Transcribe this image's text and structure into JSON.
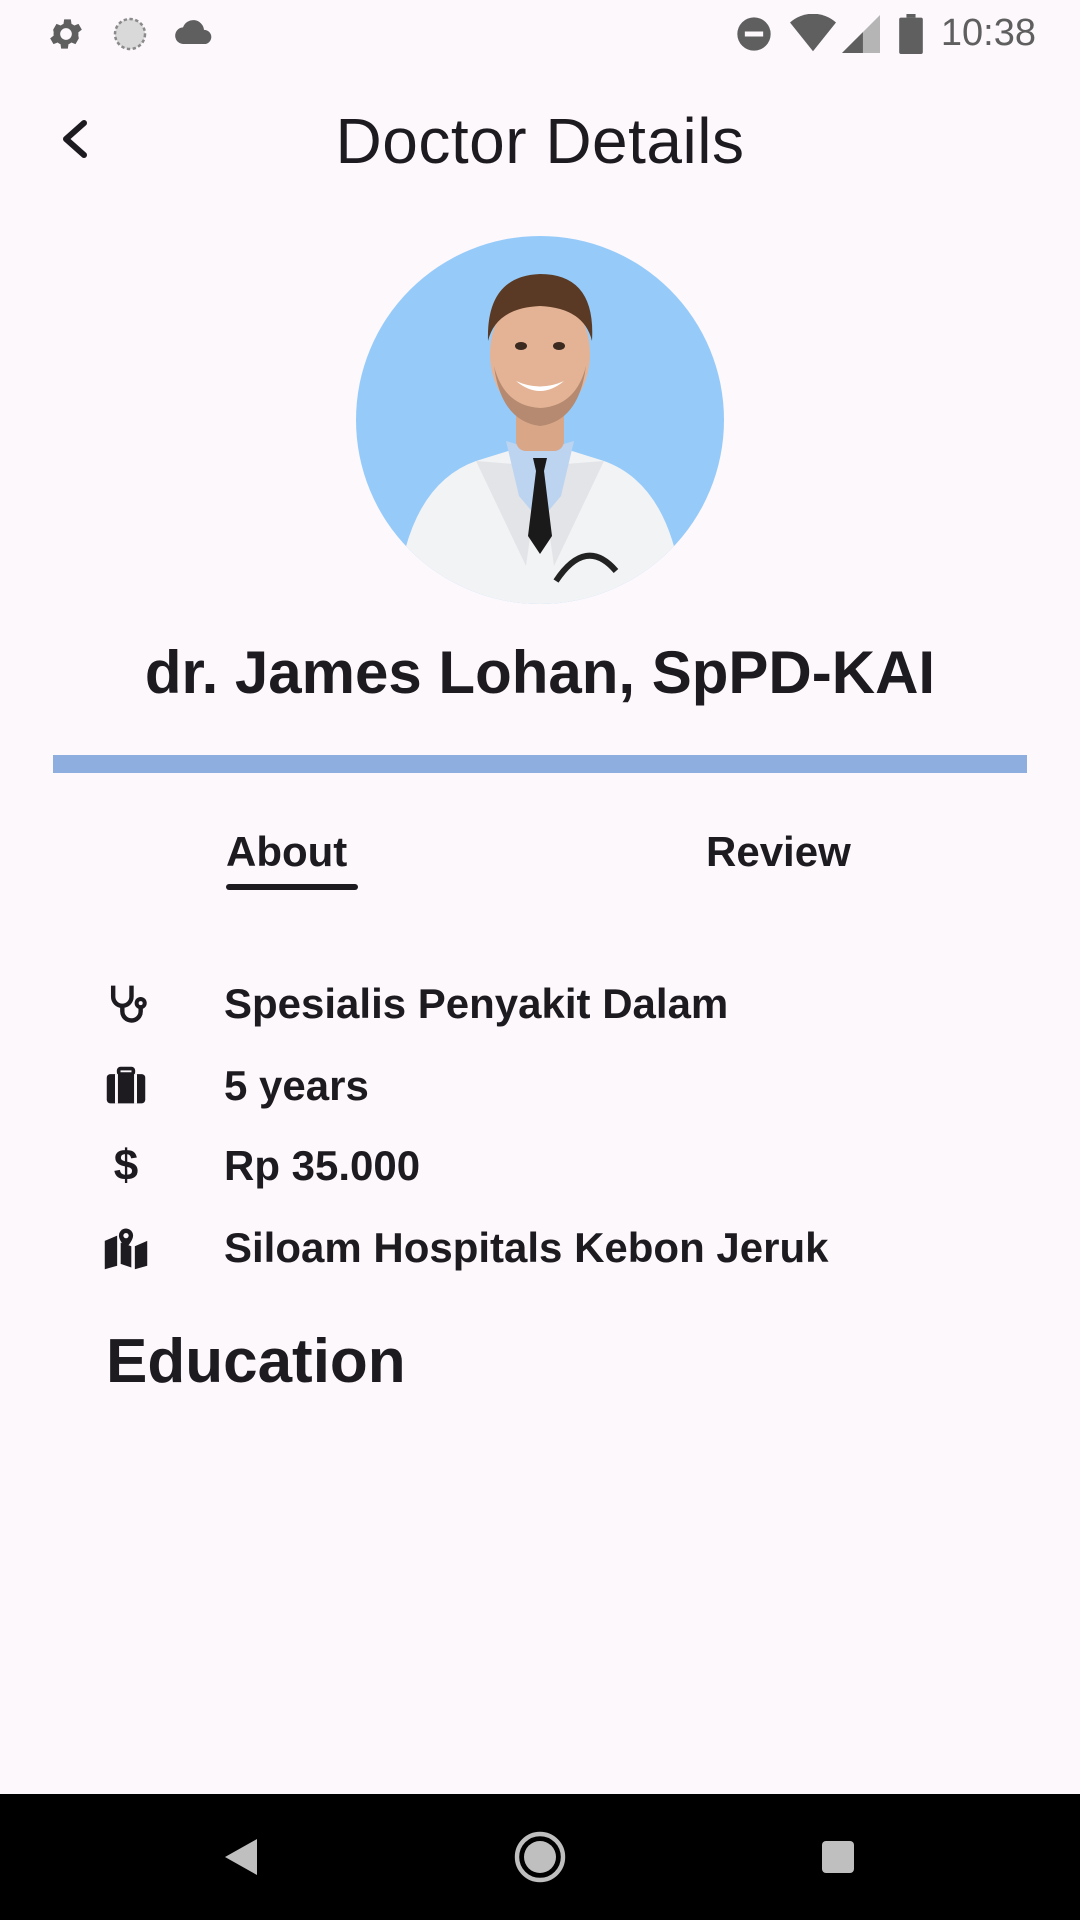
{
  "status_bar": {
    "time": "10:38",
    "left_icons": [
      "gear-icon",
      "sync-icon",
      "cloud-icon"
    ],
    "right_icons": [
      "do-not-disturb-icon",
      "wifi-icon",
      "signal-icon",
      "battery-icon"
    ]
  },
  "app_bar": {
    "title": "Doctor Details",
    "back_icon": "chevron-left-icon"
  },
  "doctor": {
    "name": "dr. James Lohan, SpPD-KAI",
    "avatar_bg": "#96cbf9"
  },
  "accent_bar_color": "#8faee0",
  "tabs": [
    {
      "label": "About",
      "selected": true
    },
    {
      "label": "Review",
      "selected": false
    }
  ],
  "info": [
    {
      "icon": "stethoscope-icon",
      "text": "Spesialis Penyakit Dalam"
    },
    {
      "icon": "briefcase-icon",
      "text": "5 years"
    },
    {
      "icon": "dollar-icon",
      "text": "Rp 35.000"
    },
    {
      "icon": "map-icon",
      "text": "Siloam Hospitals Kebon Jeruk"
    }
  ],
  "section": {
    "education_title": "Education"
  },
  "nav_bar": {
    "icons": [
      "back-triangle-icon",
      "home-circle-icon",
      "recents-square-icon"
    ]
  }
}
